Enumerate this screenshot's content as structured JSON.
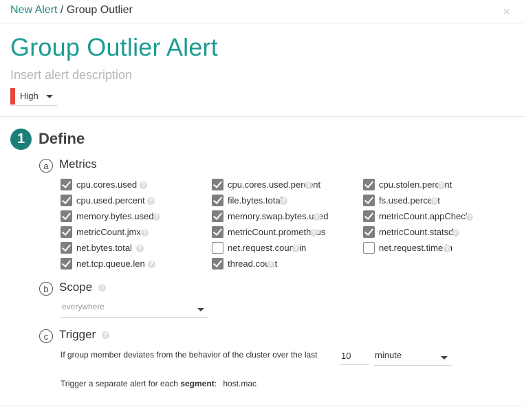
{
  "breadcrumb": {
    "parent": "New Alert",
    "separator": "/",
    "current": "Group Outlier"
  },
  "close_icon": "×",
  "title": "Group Outlier Alert",
  "description_placeholder": "Insert alert description",
  "severity": {
    "label": "High",
    "color": "#e8473e"
  },
  "accent_color": "#1b9c92",
  "step": {
    "number": "1",
    "title": "Define"
  },
  "metrics_section": {
    "letter": "a",
    "title": "Metrics",
    "columns": [
      [
        {
          "name": "cpu.cores.used",
          "checked": true
        },
        {
          "name": "cpu.used.percent",
          "checked": true
        },
        {
          "name": "memory.bytes.used",
          "checked": true
        },
        {
          "name": "metricCount.jmx",
          "checked": true
        },
        {
          "name": "net.bytes.total",
          "checked": true
        },
        {
          "name": "net.tcp.queue.len",
          "checked": true
        }
      ],
      [
        {
          "name": "cpu.cores.used.percent",
          "checked": true
        },
        {
          "name": "file.bytes.total",
          "checked": true
        },
        {
          "name": "memory.swap.bytes.used",
          "checked": true
        },
        {
          "name": "metricCount.prometheus",
          "checked": true
        },
        {
          "name": "net.request.count.in",
          "checked": false
        },
        {
          "name": "thread.count",
          "checked": true
        }
      ],
      [
        {
          "name": "cpu.stolen.percent",
          "checked": true
        },
        {
          "name": "fs.used.percent",
          "checked": true
        },
        {
          "name": "metricCount.appCheck",
          "checked": true
        },
        {
          "name": "metricCount.statsd",
          "checked": true
        },
        {
          "name": "net.request.time.in",
          "checked": false
        }
      ]
    ]
  },
  "scope_section": {
    "letter": "b",
    "title": "Scope",
    "value": "everywhere"
  },
  "trigger_section": {
    "letter": "c",
    "title": "Trigger",
    "text": "If group member deviates from the behavior of the cluster over the last",
    "amount": "10",
    "unit": "minute",
    "segment_prefix": "Trigger a separate alert for each",
    "segment_word": "segment",
    "segment_colon": ":",
    "segment_value": "host.mac"
  },
  "help_glyph": "?"
}
